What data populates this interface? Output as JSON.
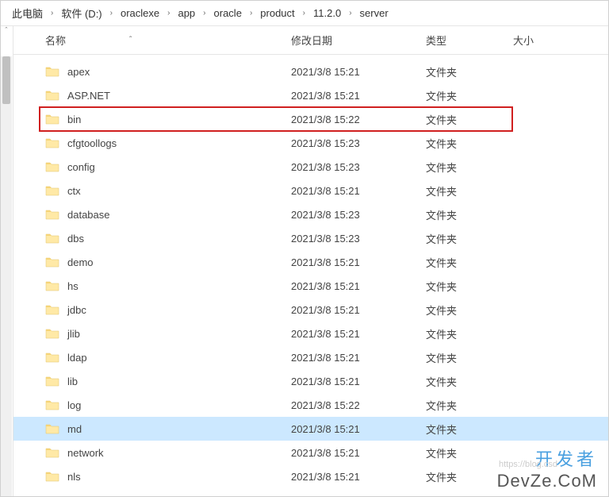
{
  "breadcrumb": [
    "此电脑",
    "软件 (D:)",
    "oraclexe",
    "app",
    "oracle",
    "product",
    "11.2.0",
    "server"
  ],
  "columns": {
    "name": "名称",
    "date": "修改日期",
    "type": "类型",
    "size": "大小"
  },
  "type_folder": "文件夹",
  "rows": [
    {
      "name": "apex",
      "date": "2021/3/8 15:21",
      "highlighted": false,
      "selected": false
    },
    {
      "name": "ASP.NET",
      "date": "2021/3/8 15:21",
      "highlighted": false,
      "selected": false
    },
    {
      "name": "bin",
      "date": "2021/3/8 15:22",
      "highlighted": true,
      "selected": false
    },
    {
      "name": "cfgtoollogs",
      "date": "2021/3/8 15:23",
      "highlighted": false,
      "selected": false
    },
    {
      "name": "config",
      "date": "2021/3/8 15:23",
      "highlighted": false,
      "selected": false
    },
    {
      "name": "ctx",
      "date": "2021/3/8 15:21",
      "highlighted": false,
      "selected": false
    },
    {
      "name": "database",
      "date": "2021/3/8 15:23",
      "highlighted": false,
      "selected": false
    },
    {
      "name": "dbs",
      "date": "2021/3/8 15:23",
      "highlighted": false,
      "selected": false
    },
    {
      "name": "demo",
      "date": "2021/3/8 15:21",
      "highlighted": false,
      "selected": false
    },
    {
      "name": "hs",
      "date": "2021/3/8 15:21",
      "highlighted": false,
      "selected": false
    },
    {
      "name": "jdbc",
      "date": "2021/3/8 15:21",
      "highlighted": false,
      "selected": false
    },
    {
      "name": "jlib",
      "date": "2021/3/8 15:21",
      "highlighted": false,
      "selected": false
    },
    {
      "name": "ldap",
      "date": "2021/3/8 15:21",
      "highlighted": false,
      "selected": false
    },
    {
      "name": "lib",
      "date": "2021/3/8 15:21",
      "highlighted": false,
      "selected": false
    },
    {
      "name": "log",
      "date": "2021/3/8 15:22",
      "highlighted": false,
      "selected": false
    },
    {
      "name": "md",
      "date": "2021/3/8 15:21",
      "highlighted": false,
      "selected": true
    },
    {
      "name": "network",
      "date": "2021/3/8 15:21",
      "highlighted": false,
      "selected": false
    },
    {
      "name": "nls",
      "date": "2021/3/8 15:21",
      "highlighted": false,
      "selected": false
    }
  ],
  "watermark": {
    "line1": "开发者",
    "line2": "DevZe.CoM",
    "blog": "https://blog.csd"
  }
}
